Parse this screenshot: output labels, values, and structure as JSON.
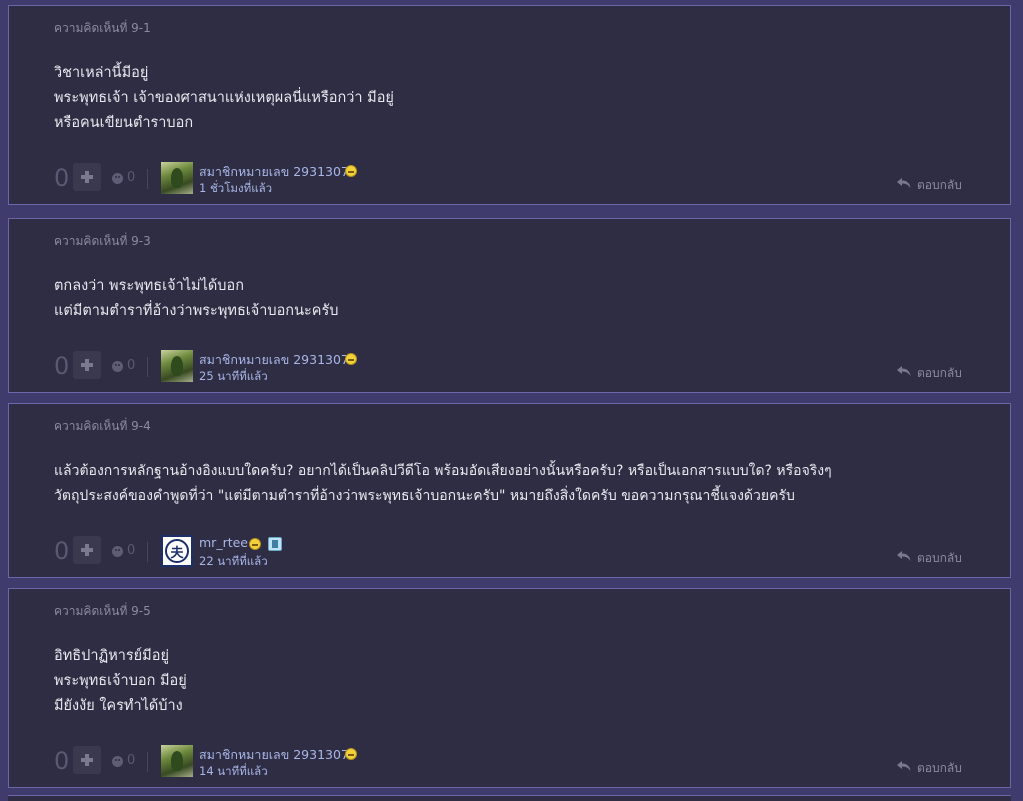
{
  "comments": [
    {
      "title": "ความคิดเห็นที่ 9-1",
      "lines": [
        "วิชาเหล่านี้มีอยู่",
        "พระพุทธเจ้า เจ้าของศาสนาแห่งเหตุผลนี่แหรือกว่า มีอยู่",
        "หรือคนเขียนตำราบอก"
      ],
      "vote": "0",
      "emo_count": "0",
      "username": "สมาชิกหมายเลข 2931307",
      "time": "1 ชั่วโมงที่แล้ว",
      "avatar": "photo"
    },
    {
      "title": "ความคิดเห็นที่ 9-3",
      "lines": [
        "ตกลงว่า พระพุทธเจ้าไม่ได้บอก",
        "แต่มีตามตำราที่อ้างว่าพระพุทธเจ้าบอกนะครับ"
      ],
      "vote": "0",
      "emo_count": "0",
      "username": "สมาชิกหมายเลข 2931307",
      "time": "25 นาทีที่แล้ว",
      "avatar": "photo"
    },
    {
      "title": "ความคิดเห็นที่ 9-4",
      "lines": [
        "แล้วต้องการหลักฐานอ้างอิงแบบใดครับ? อยากได้เป็นคลิปวีดีโอ พร้อมอัดเสียงอย่างนั้นหรือครับ? หรือเป็นเอกสารแบบใด? หรือจริงๆ",
        "วัตถุประสงค์ของคำพูดที่ว่า \"แต่มีตามตำราที่อ้างว่าพระพุทธเจ้าบอกนะครับ\" หมายถึงสิ่งใดครับ ขอความกรุณาชี้แจงด้วยครับ"
      ],
      "vote": "0",
      "emo_count": "0",
      "username": "mr_rtee",
      "time": "22 นาทีที่แล้ว",
      "avatar": "logo",
      "avatar_glyph": "夫"
    },
    {
      "title": "ความคิดเห็นที่ 9-5",
      "lines": [
        "อิทธิปาฏิหารย์มีอยู่",
        "พระพุทธเจ้าบอก มีอยู่",
        "มียังงัย ใครทำได้บ้าง"
      ],
      "vote": "0",
      "emo_count": "0",
      "username": "สมาชิกหมายเลข 2931307",
      "time": "14 นาทีที่แล้ว",
      "avatar": "photo"
    }
  ],
  "reply_label": "ตอบกลับ",
  "icons": {
    "plus": "plus-icon",
    "emotion": "emotion-icon",
    "smile": "smile-icon",
    "reply": "reply-arrow-icon",
    "badge": "member-badge-icon"
  },
  "colors": {
    "page_bg": "#3f3b6c",
    "card_bg": "#2e2d44",
    "card_border": "#6a66a8",
    "link": "#a9b6e6",
    "muted": "#8c8aa2"
  }
}
